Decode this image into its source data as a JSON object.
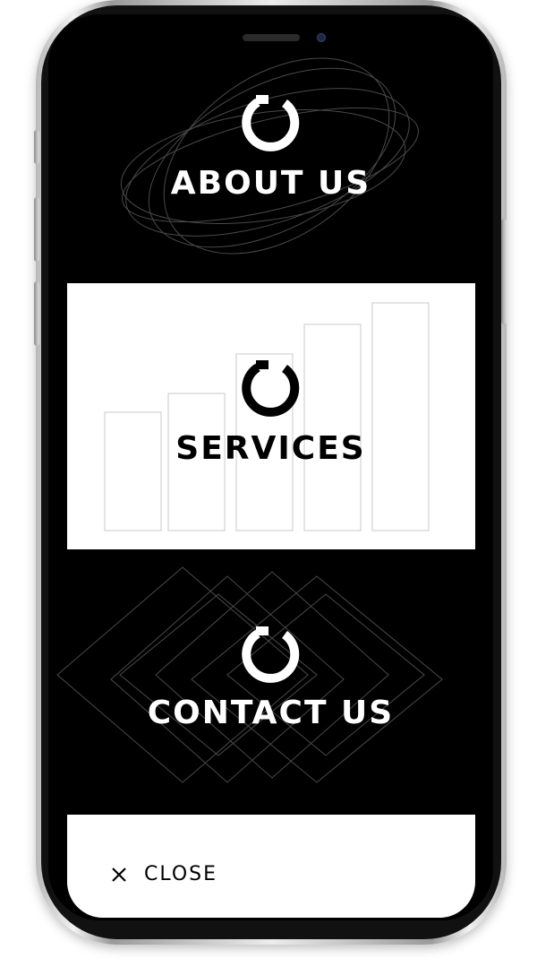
{
  "menu": {
    "items": [
      {
        "label": "ABOUT US",
        "icon": "logo-ring-icon"
      },
      {
        "label": "SERVICES",
        "icon": "logo-ring-icon"
      },
      {
        "label": "CONTACT US",
        "icon": "logo-ring-icon"
      }
    ],
    "close_label": "CLOSE",
    "close_icon": "close-icon"
  },
  "colors": {
    "background_dark": "#000000",
    "background_light": "#ffffff",
    "text_light": "#ffffff",
    "text_dark": "#000000",
    "deco_lines": "#555555"
  }
}
